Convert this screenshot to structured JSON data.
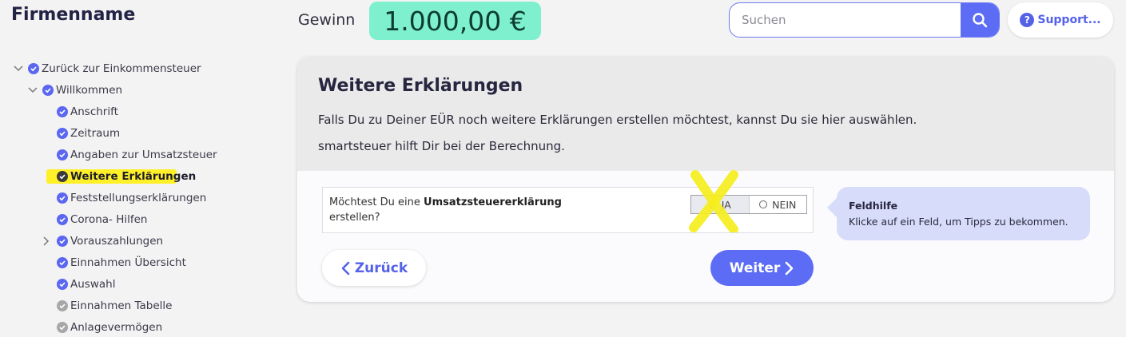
{
  "brand": "Firmenname",
  "header": {
    "gewinn_label": "Gewinn",
    "gewinn_value": "1.000,00 €",
    "search_placeholder": "Suchen",
    "support_label": "Support..."
  },
  "sidebar": {
    "items": [
      {
        "label": "Zurück zur Einkommensteuer",
        "status": "done",
        "chevron": "down"
      },
      {
        "label": "Willkommen",
        "status": "done",
        "chevron": "down"
      },
      {
        "label": "Anschrift",
        "status": "done"
      },
      {
        "label": "Zeitraum",
        "status": "done"
      },
      {
        "label": "Angaben zur Umsatzsteuer",
        "status": "done"
      },
      {
        "label": "Weitere Erklärungen",
        "status": "current",
        "highlighted": true
      },
      {
        "label": "Feststellungserklärungen",
        "status": "done"
      },
      {
        "label": "Corona- Hilfen",
        "status": "done"
      },
      {
        "label": "Vorauszahlungen",
        "status": "done",
        "chevron": "right"
      },
      {
        "label": "Einnahmen Übersicht",
        "status": "done"
      },
      {
        "label": "Auswahl",
        "status": "done"
      },
      {
        "label": "Einnahmen Tabelle",
        "status": "pending"
      },
      {
        "label": "Anlagevermögen",
        "status": "pending"
      }
    ]
  },
  "main": {
    "title": "Weitere Erklärungen",
    "desc_line1": "Falls Du zu Deiner EÜR noch weitere Erklärungen erstellen möchtest, kannst Du sie hier auswählen.",
    "desc_line2": "smartsteuer hilft Dir bei der Berechnung.",
    "question": {
      "prefix": "Möchtest Du eine ",
      "bold": "Umsatzsteuererklärung",
      "suffix": "erstellen?",
      "options": [
        "JA",
        "NEIN"
      ],
      "selected": "JA"
    },
    "back_label": "Zurück",
    "next_label": "Weiter"
  },
  "help": {
    "title": "Feldhilfe",
    "text": "Klicke auf ein Feld, um Tipps zu bekommen."
  },
  "colors": {
    "accent": "#5c6cf5",
    "gewinn_bg": "#7ff0cd",
    "highlight": "#fff028",
    "annotation_x": "#f5ee1e",
    "help_bg": "#d8dcfb"
  }
}
